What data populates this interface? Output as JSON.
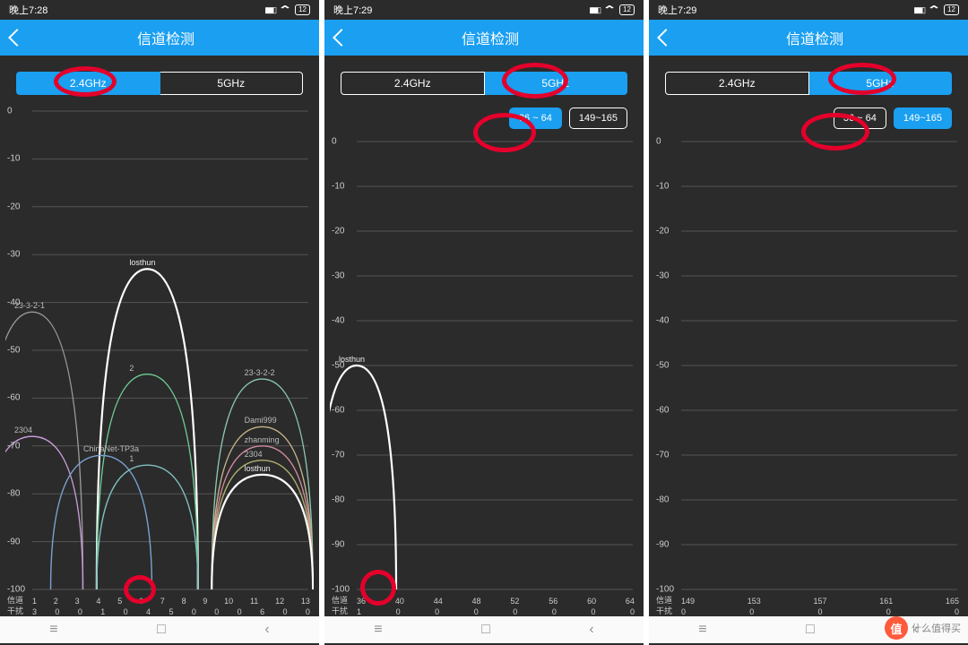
{
  "watermark": {
    "badge": "值",
    "text": "什么值得买"
  },
  "nav_soft": {
    "recent": "≡",
    "home": "□",
    "back": "‹"
  },
  "status_icons": {
    "signal": "signal-icon",
    "wifi": "wifi-icon"
  },
  "screens": [
    {
      "time": "晚上7:28",
      "battery": "12",
      "title": "信道检测",
      "band_tabs": {
        "a": "2.4GHz",
        "b": "5GHz",
        "active": "a"
      },
      "sub_tabs": null,
      "chart_data": {
        "type": "line",
        "ylabel": "",
        "ylim": [
          -100,
          0
        ],
        "yticks": [
          0,
          -10,
          -20,
          -30,
          -40,
          -50,
          -60,
          -70,
          -80,
          -90,
          -100
        ],
        "x_label_top": "信道",
        "x_label_bottom": "干扰",
        "channels": [
          1,
          2,
          3,
          4,
          5,
          6,
          7,
          8,
          9,
          10,
          11,
          12,
          13
        ],
        "interference": [
          3,
          0,
          0,
          1,
          0,
          4,
          5,
          0,
          0,
          0,
          6,
          0,
          0
        ],
        "series": [
          {
            "name": "losthun",
            "center_ch": 6,
            "peak_db": -33,
            "half_span": 2.2,
            "color": "#ffffff",
            "own": true
          },
          {
            "name": "23-3-2-1",
            "center_ch": 1,
            "peak_db": -42,
            "half_span": 2.2,
            "color": "#9a9a9a"
          },
          {
            "name": "2",
            "center_ch": 6,
            "peak_db": -55,
            "half_span": 2.2,
            "color": "#6fcf97"
          },
          {
            "name": "23-3-2-2",
            "center_ch": 11,
            "peak_db": -56,
            "half_span": 2.2,
            "color": "#8bc7b0"
          },
          {
            "name": "2304",
            "center_ch": 1,
            "peak_db": -68,
            "half_span": 2.2,
            "color": "#c59bd6"
          },
          {
            "name": "Dami999",
            "center_ch": 11,
            "peak_db": -66,
            "half_span": 2.2,
            "color": "#c6b48b"
          },
          {
            "name": "ChinaNet-TP3a",
            "center_ch": 4,
            "peak_db": -72,
            "half_span": 2.2,
            "color": "#7aa3d4"
          },
          {
            "name": "zhanming",
            "center_ch": 11,
            "peak_db": -70,
            "half_span": 2.2,
            "color": "#d48ba0"
          },
          {
            "name": "2304",
            "center_ch": 11,
            "peak_db": -73,
            "half_span": 2.2,
            "color": "#b0b070"
          },
          {
            "name": "1",
            "center_ch": 6,
            "peak_db": -74,
            "half_span": 2.2,
            "color": "#80c0c0"
          },
          {
            "name": "losthun",
            "center_ch": 11,
            "peak_db": -76,
            "half_span": 2.2,
            "color": "#ffffff",
            "own": true
          }
        ]
      },
      "annotations": [
        {
          "shape": "ellipse",
          "target": "tab-2.4GHz"
        },
        {
          "shape": "ellipse",
          "target": "channel-6-interference"
        }
      ]
    },
    {
      "time": "晚上7:29",
      "battery": "12",
      "title": "信道检测",
      "band_tabs": {
        "a": "2.4GHz",
        "b": "5GHz",
        "active": "b"
      },
      "sub_tabs": {
        "a": "36 ~ 64",
        "b": "149~165",
        "active": "a"
      },
      "chart_data": {
        "type": "line",
        "ylim": [
          -100,
          0
        ],
        "yticks": [
          0,
          -10,
          -20,
          -30,
          -40,
          -50,
          -60,
          -70,
          -80,
          -90,
          -100
        ],
        "x_label_top": "信道",
        "x_label_bottom": "干扰",
        "channels": [
          36,
          40,
          44,
          48,
          52,
          56,
          60,
          64
        ],
        "interference": [
          1,
          0,
          0,
          0,
          0,
          0,
          0,
          0
        ],
        "series": [
          {
            "name": "losthun",
            "center_ch": 36,
            "peak_db": -50,
            "half_span": 4,
            "color": "#ffffff",
            "own": true
          }
        ]
      },
      "annotations": [
        {
          "shape": "ellipse",
          "target": "tab-5GHz"
        },
        {
          "shape": "ellipse",
          "target": "subtab-36-64"
        },
        {
          "shape": "ellipse",
          "target": "channel-36-interference"
        }
      ]
    },
    {
      "time": "晚上7:29",
      "battery": "12",
      "title": "信道检测",
      "band_tabs": {
        "a": "2.4GHz",
        "b": "5GHz",
        "active": "b"
      },
      "sub_tabs": {
        "a": "36 ~ 64",
        "b": "149~165",
        "active": "b"
      },
      "chart_data": {
        "type": "line",
        "ylim": [
          -100,
          0
        ],
        "yticks": [
          0,
          -10,
          -20,
          -30,
          -40,
          -50,
          -60,
          -70,
          -80,
          -90,
          -100
        ],
        "x_label_top": "信道",
        "x_label_bottom": "干扰",
        "channels": [
          149,
          153,
          157,
          161,
          165
        ],
        "interference": [
          0,
          0,
          0,
          0,
          0
        ],
        "series": []
      },
      "annotations": [
        {
          "shape": "ellipse",
          "target": "tab-5GHz"
        },
        {
          "shape": "ellipse",
          "target": "subtab-36-64"
        }
      ]
    }
  ]
}
